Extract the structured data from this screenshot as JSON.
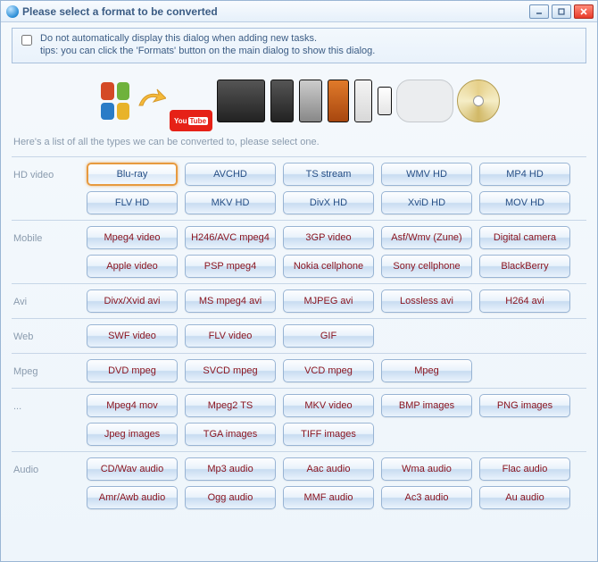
{
  "window": {
    "title": "Please select a format to be converted"
  },
  "notice": {
    "line1": "Do not automatically display this dialog when adding new tasks.",
    "line2": "tips: you can click the 'Formats' button on the main dialog to show this dialog."
  },
  "intro": "Here's a list of all the types we can be converted to, please select one.",
  "selected": "Blu-ray",
  "categories": [
    {
      "key": "hd",
      "label": "HD video",
      "items": [
        "Blu-ray",
        "AVCHD",
        "TS stream",
        "WMV HD",
        "MP4 HD",
        "FLV HD",
        "MKV HD",
        "DivX HD",
        "XviD HD",
        "MOV HD"
      ]
    },
    {
      "key": "mobile",
      "label": "Mobile",
      "items": [
        "Mpeg4 video",
        "H246/AVC mpeg4",
        "3GP video",
        "Asf/Wmv (Zune)",
        "Digital camera",
        "Apple video",
        "PSP mpeg4",
        "Nokia cellphone",
        "Sony cellphone",
        "BlackBerry"
      ]
    },
    {
      "key": "avi",
      "label": "Avi",
      "items": [
        "Divx/Xvid avi",
        "MS mpeg4 avi",
        "MJPEG avi",
        "Lossless avi",
        "H264 avi"
      ]
    },
    {
      "key": "web",
      "label": "Web",
      "items": [
        "SWF video",
        "FLV video",
        "GIF"
      ]
    },
    {
      "key": "mpeg",
      "label": "Mpeg",
      "items": [
        "DVD mpeg",
        "SVCD mpeg",
        "VCD mpeg",
        "Mpeg"
      ]
    },
    {
      "key": "other",
      "label": "...",
      "items": [
        "Mpeg4 mov",
        "Mpeg2 TS",
        "MKV video",
        "BMP images",
        "PNG images",
        "Jpeg images",
        "TGA images",
        "TIFF images"
      ]
    },
    {
      "key": "audio",
      "label": "Audio",
      "items": [
        "CD/Wav audio",
        "Mp3 audio",
        "Aac audio",
        "Wma audio",
        "Flac audio",
        "Amr/Awb audio",
        "Ogg audio",
        "MMF audio",
        "Ac3 audio",
        "Au audio"
      ]
    }
  ]
}
